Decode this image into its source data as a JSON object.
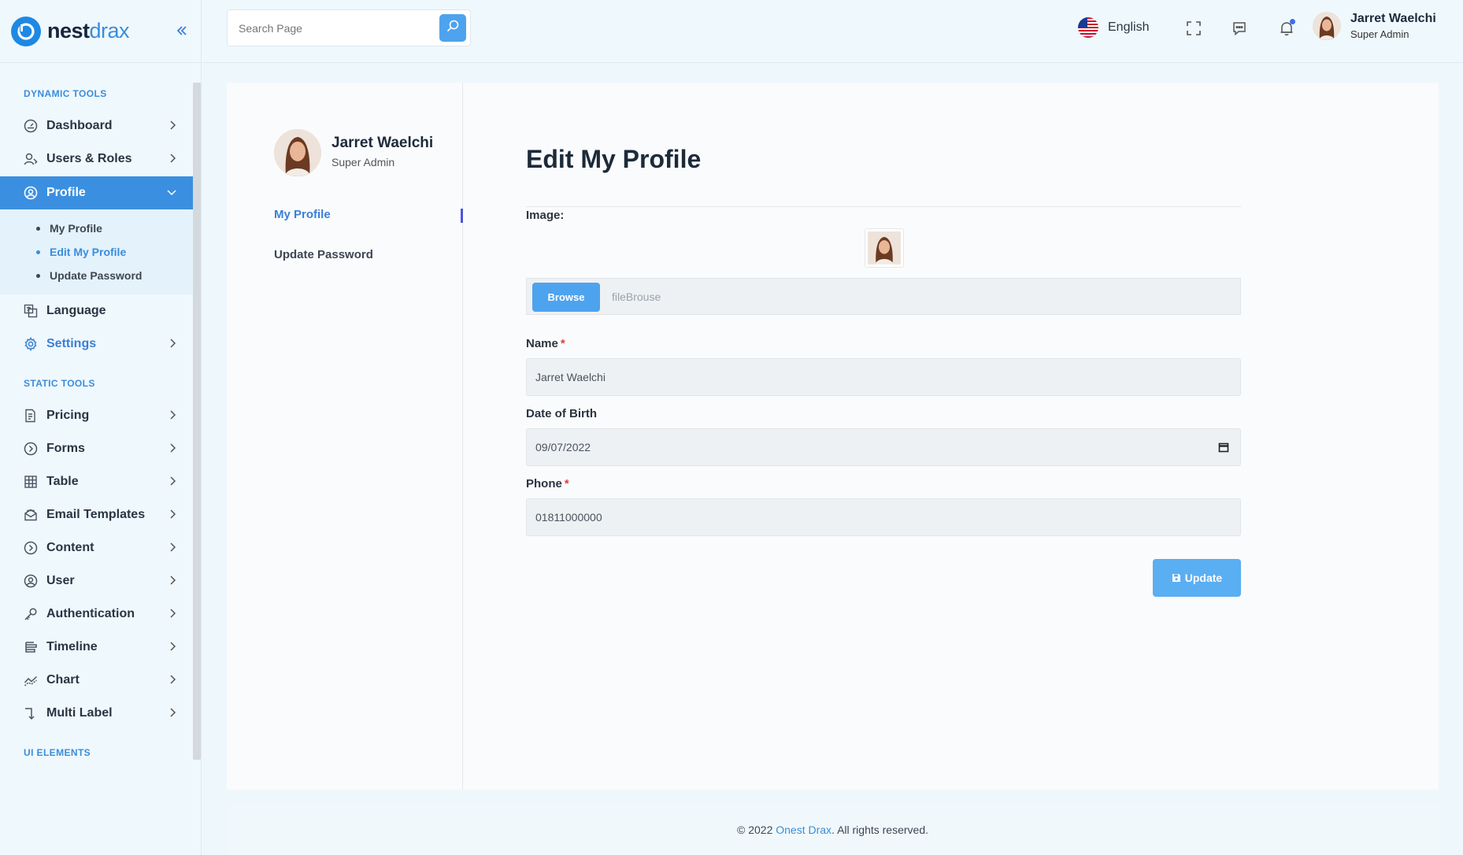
{
  "brand": {
    "name_bold": "nest",
    "name_light": "drax"
  },
  "sidebar": {
    "sections": {
      "dynamic": "DYNAMIC TOOLS",
      "static": "STATIC TOOLS",
      "ui": "UI ELEMENTS"
    },
    "items": [
      {
        "label": "Dashboard",
        "icon": "gauge-icon"
      },
      {
        "label": "Users & Roles",
        "icon": "user-roles-icon"
      },
      {
        "label": "Profile",
        "icon": "profile-circle-icon"
      },
      {
        "label": "Language",
        "icon": "language-icon"
      },
      {
        "label": "Settings",
        "icon": "gear-icon"
      },
      {
        "label": "Pricing",
        "icon": "pricing-icon"
      },
      {
        "label": "Forms",
        "icon": "circle-chevron-icon"
      },
      {
        "label": "Table",
        "icon": "table-icon"
      },
      {
        "label": "Email Templates",
        "icon": "email-icon"
      },
      {
        "label": "Content",
        "icon": "circle-chevron-icon"
      },
      {
        "label": "User",
        "icon": "profile-circle-icon"
      },
      {
        "label": "Authentication",
        "icon": "key-icon"
      },
      {
        "label": "Timeline",
        "icon": "timeline-icon"
      },
      {
        "label": "Chart",
        "icon": "chart-line-icon"
      },
      {
        "label": "Multi Label",
        "icon": "multi-level-icon"
      }
    ],
    "profile_sub": [
      "My Profile",
      "Edit My Profile",
      "Update Password"
    ]
  },
  "header": {
    "search_placeholder": "Search Page",
    "language": "English",
    "user_name": "Jarret Waelchi",
    "user_role": "Super Admin"
  },
  "profile_card": {
    "name": "Jarret Waelchi",
    "role": "Super Admin",
    "links": [
      "My Profile",
      "Update Password"
    ]
  },
  "form": {
    "title": "Edit My Profile",
    "image_label": "Image:",
    "browse_label": "Browse",
    "file_placeholder": "fileBrouse",
    "name_label": "Name",
    "name_value": "Jarret Waelchi",
    "dob_label": "Date of Birth",
    "dob_value": "09/07/2022",
    "phone_label": "Phone",
    "phone_value": "01811000000",
    "required_mark": "*",
    "update_label": "Update"
  },
  "footer": {
    "prefix": "© 2022 ",
    "link": "Onest Drax",
    "suffix": ". All rights reserved."
  },
  "colors": {
    "accent": "#3b8fe0",
    "button": "#4ea3ee",
    "required": "#e23b3b"
  }
}
